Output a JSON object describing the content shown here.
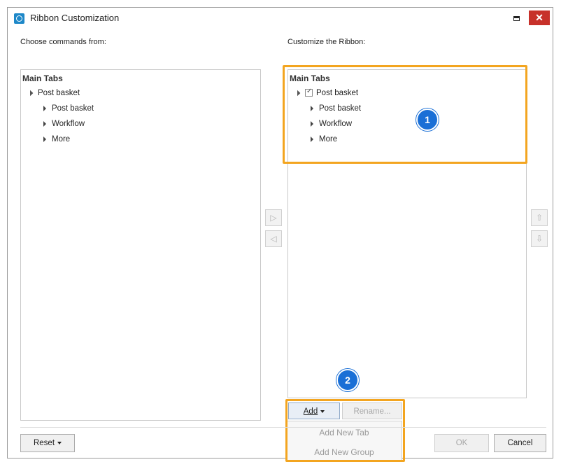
{
  "window": {
    "title": "Ribbon Customization"
  },
  "left": {
    "label": "Choose commands from:",
    "header": "Main Tabs",
    "items": [
      {
        "label": "Post basket",
        "level": 0,
        "expanded": true
      },
      {
        "label": "Post basket",
        "level": 1,
        "expanded": false
      },
      {
        "label": "Workflow",
        "level": 1,
        "expanded": false
      },
      {
        "label": "More",
        "level": 1,
        "expanded": false
      }
    ]
  },
  "right": {
    "label": "Customize the Ribbon:",
    "header": "Main Tabs",
    "items": [
      {
        "label": "Post basket",
        "level": 0,
        "expanded": true,
        "checked": true
      },
      {
        "label": "Post basket",
        "level": 1,
        "expanded": false
      },
      {
        "label": "Workflow",
        "level": 1,
        "expanded": false
      },
      {
        "label": "More",
        "level": 1,
        "expanded": false
      }
    ]
  },
  "buttons": {
    "add": "Add",
    "rename": "Rename...",
    "reset": "Reset",
    "ok": "OK",
    "cancel": "Cancel"
  },
  "add_menu": {
    "items": [
      "Add New Tab",
      "Add New Group"
    ]
  },
  "callouts": {
    "badge1": "1",
    "badge2": "2"
  },
  "icons": {
    "window_icon": "ribbon-app-icon",
    "close": "close-icon",
    "maximize": "maximize-icon",
    "move_right": "arrow-right-icon",
    "move_left": "arrow-left-icon",
    "move_up": "arrow-up-icon",
    "move_down": "arrow-down-icon"
  },
  "colors": {
    "highlight": "#f3a520",
    "badge": "#1a6fd6",
    "close_button": "#c7312a"
  }
}
